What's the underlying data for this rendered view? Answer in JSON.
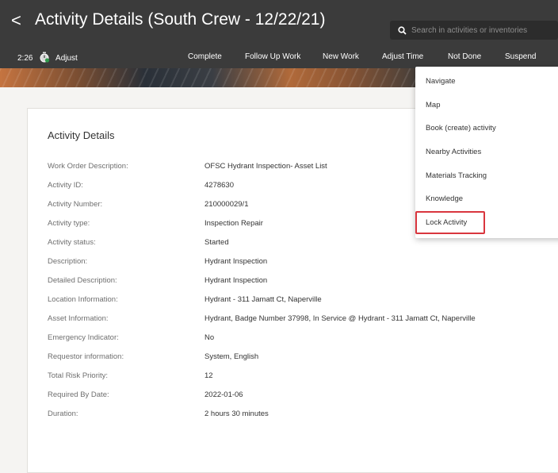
{
  "header": {
    "back_glyph": "<",
    "title": "Activity Details (South Crew - 12/22/21)",
    "search_placeholder": "Search in activities or inventories",
    "search_value": ""
  },
  "toolbar": {
    "timer": "2:26",
    "adjust": "Adjust",
    "complete": "Complete",
    "follow_up": "Follow Up Work",
    "new_work": "New Work",
    "adjust_time": "Adjust Time",
    "not_done": "Not Done",
    "suspend": "Suspend"
  },
  "details": {
    "title": "Activity Details",
    "rows": [
      {
        "label": "Work Order Description:",
        "value": "OFSC Hydrant Inspection- Asset List"
      },
      {
        "label": "Activity ID:",
        "value": "4278630"
      },
      {
        "label": "Activity Number:",
        "value": "210000029/1"
      },
      {
        "label": "Activity type:",
        "value": "Inspection Repair"
      },
      {
        "label": "Activity status:",
        "value": "Started"
      },
      {
        "label": "Description:",
        "value": "Hydrant Inspection"
      },
      {
        "label": "Detailed Description:",
        "value": "Hydrant Inspection"
      },
      {
        "label": "Location Information:",
        "value": "Hydrant - 311 Jamatt Ct, Naperville"
      },
      {
        "label": "Asset Information:",
        "value": "Hydrant, Badge Number 37998, In Service @ Hydrant - 311 Jamatt Ct, Naperville"
      },
      {
        "label": "Emergency Indicator:",
        "value": "No"
      },
      {
        "label": "Requestor information:",
        "value": "System, English"
      },
      {
        "label": "Total Risk Priority:",
        "value": "12"
      },
      {
        "label": "Required By Date:",
        "value": "2022-01-06"
      },
      {
        "label": "Duration:",
        "value": "2 hours 30 minutes"
      }
    ]
  },
  "menu": {
    "items": [
      "Navigate",
      "Map",
      "Book (create) activity",
      "Nearby Activities",
      "Materials Tracking",
      "Knowledge",
      "Lock Activity"
    ],
    "highlighted": "Lock Activity"
  },
  "colors": {
    "header_bg": "#3b3b3b",
    "highlight_border": "#d9363e"
  },
  "icons": [
    "back-chevron-icon",
    "search-icon",
    "stopwatch-icon"
  ]
}
